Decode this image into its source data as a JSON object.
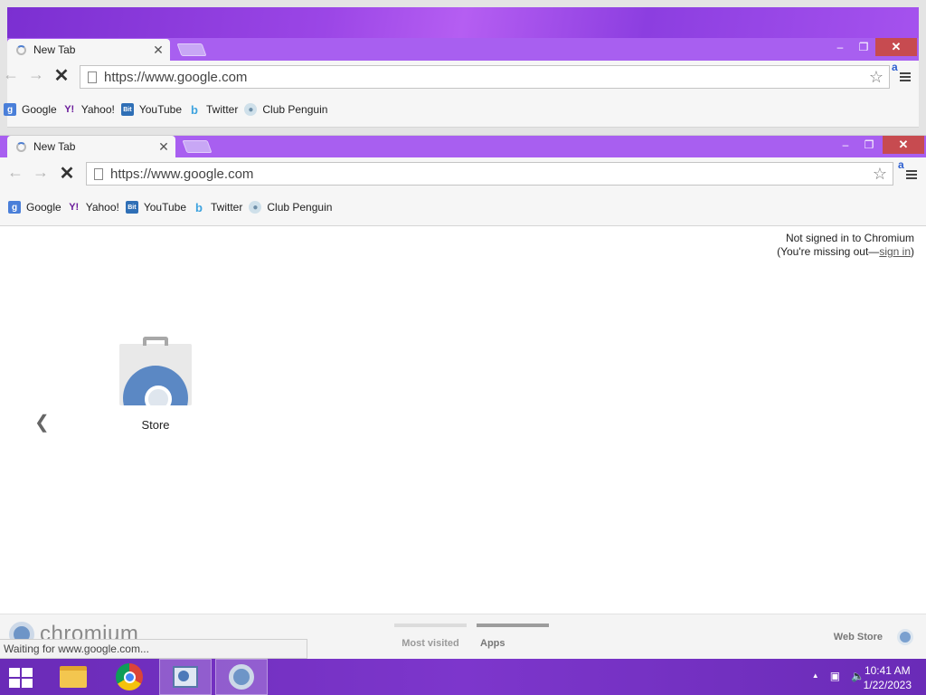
{
  "tab": {
    "title": "New Tab"
  },
  "omnibox": {
    "url": "https://www.google.com"
  },
  "window_controls": {
    "minimize": "–",
    "maximize": "❐",
    "close": "✕"
  },
  "nav": {
    "back": "←",
    "forward": "→",
    "stop": "✕"
  },
  "extension": {
    "label": "a"
  },
  "bookmarks": [
    {
      "label": "Google",
      "icon": "google-icon",
      "glyph": "g"
    },
    {
      "label": "Yahoo!",
      "icon": "yahoo-icon",
      "glyph": "Y!"
    },
    {
      "label": "YouTube",
      "icon": "youtube-icon",
      "glyph": "Bit"
    },
    {
      "label": "Twitter",
      "icon": "twitter-icon",
      "glyph": "b"
    },
    {
      "label": "Club Penguin",
      "icon": "club-penguin-icon",
      "glyph": "●"
    }
  ],
  "signin": {
    "line1": "Not signed in to Chromium",
    "line2_prefix": "(You're missing out—",
    "link": "sign in",
    "line2_suffix": ")"
  },
  "apps": [
    {
      "label": "Store",
      "icon": "web-store-icon"
    }
  ],
  "pager": {
    "prev": "❮"
  },
  "footer": {
    "logo_text": "chromium",
    "most_visited": "Most visited",
    "apps": "Apps",
    "web_store": "Web Store"
  },
  "status": {
    "text": "Waiting for www.google.com..."
  },
  "taskbar": {
    "items": [
      "file-explorer-icon",
      "chrome-icon",
      "remote-desktop-icon",
      "chromium-icon"
    ],
    "tray": {
      "up_arrow": "▲",
      "network": "▣",
      "volume": "🔈"
    },
    "clock": {
      "time": "10:41 AM",
      "date": "1/22/2023"
    }
  },
  "colors": {
    "tabstrip": "#a85ff0",
    "close_button": "#c74b50",
    "taskbar": "#7d36cc"
  }
}
